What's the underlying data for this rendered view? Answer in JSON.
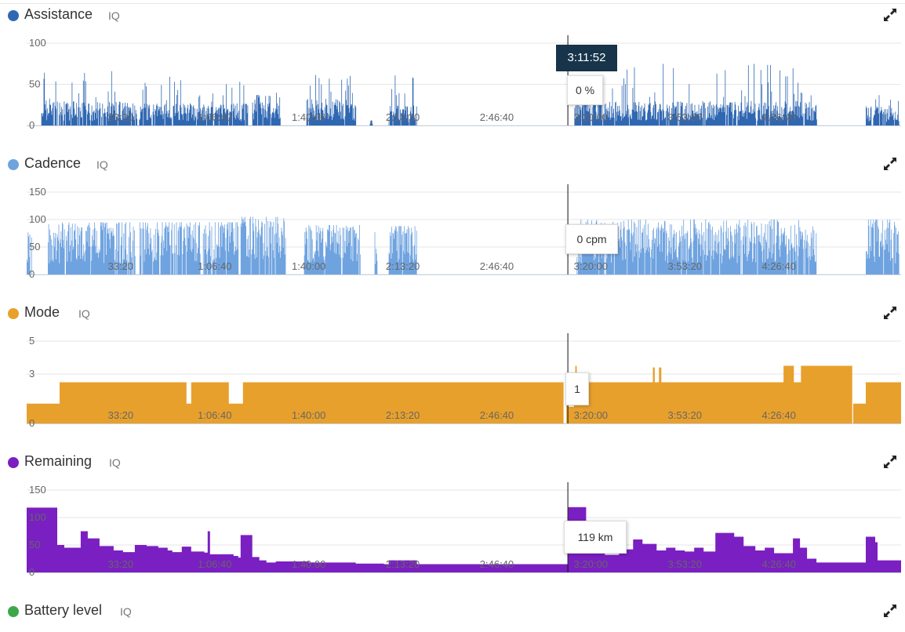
{
  "cursor": {
    "time_label": "3:11:52",
    "time_s": 11512
  },
  "x_axis": {
    "min_s": 0,
    "max_s": 18600,
    "ticks": [
      {
        "t": 2000,
        "label": "33:20"
      },
      {
        "t": 4000,
        "label": "1:06:40"
      },
      {
        "t": 6000,
        "label": "1:40:00"
      },
      {
        "t": 8000,
        "label": "2:13:20"
      },
      {
        "t": 10000,
        "label": "2:46:40"
      },
      {
        "t": 12000,
        "label": "3:20:00"
      },
      {
        "t": 14000,
        "label": "3:53:20"
      },
      {
        "t": 16000,
        "label": "4:26:40"
      }
    ]
  },
  "panels": [
    {
      "id": "assistance",
      "title": "Assistance",
      "iq": "IQ",
      "color": "#2f67b2",
      "expand_icon": "expand-arrows-icon",
      "tooltip": "0 %"
    },
    {
      "id": "cadence",
      "title": "Cadence",
      "iq": "IQ",
      "color": "#6fa3e0",
      "expand_icon": "expand-arrows-icon",
      "tooltip": "0 cpm"
    },
    {
      "id": "mode",
      "title": "Mode",
      "iq": "IQ",
      "color": "#e8a02c",
      "expand_icon": "expand-arrows-icon",
      "tooltip": "1"
    },
    {
      "id": "remaining",
      "title": "Remaining",
      "iq": "IQ",
      "color": "#7a1fc2",
      "expand_icon": "expand-arrows-icon",
      "tooltip": "119 km"
    },
    {
      "id": "battery",
      "title": "Battery level",
      "iq": "IQ",
      "color": "#3da84a",
      "expand_icon": "expand-arrows-icon"
    }
  ],
  "chart_data": [
    {
      "type": "area",
      "title": "Assistance",
      "ylim": [
        0,
        100
      ],
      "yticks": [
        0,
        50,
        100
      ],
      "unit": "%",
      "style": "spikes",
      "segments": [
        {
          "from": 300,
          "to": 2350,
          "level": 22,
          "peak": 70
        },
        {
          "from": 2380,
          "to": 4700,
          "level": 20,
          "peak": 60
        },
        {
          "from": 4800,
          "to": 5400,
          "level": 28,
          "peak": 50
        },
        {
          "from": 5950,
          "to": 7000,
          "level": 24,
          "peak": 62
        },
        {
          "from": 7300,
          "to": 7350,
          "level": 5,
          "peak": 10
        },
        {
          "from": 7700,
          "to": 8300,
          "level": 18,
          "peak": 65
        },
        {
          "from": 11650,
          "to": 16800,
          "level": 22,
          "peak": 75
        },
        {
          "from": 17850,
          "to": 18550,
          "level": 18,
          "peak": 40
        }
      ]
    },
    {
      "type": "area",
      "title": "Cadence",
      "ylim": [
        0,
        150
      ],
      "yticks": [
        0,
        50,
        100,
        150
      ],
      "unit": "cpm",
      "style": "spikes",
      "segments": [
        {
          "from": 0,
          "to": 100,
          "level": 70,
          "peak": 85
        },
        {
          "from": 450,
          "to": 2300,
          "level": 78,
          "peak": 95
        },
        {
          "from": 2400,
          "to": 3700,
          "level": 82,
          "peak": 95
        },
        {
          "from": 3750,
          "to": 4500,
          "level": 80,
          "peak": 95
        },
        {
          "from": 4550,
          "to": 5500,
          "level": 85,
          "peak": 105
        },
        {
          "from": 5900,
          "to": 7100,
          "level": 75,
          "peak": 90
        },
        {
          "from": 7400,
          "to": 7450,
          "level": 70,
          "peak": 80
        },
        {
          "from": 7700,
          "to": 8300,
          "level": 72,
          "peak": 88
        },
        {
          "from": 11700,
          "to": 16800,
          "level": 78,
          "peak": 100
        },
        {
          "from": 17850,
          "to": 18550,
          "level": 80,
          "peak": 100
        }
      ]
    },
    {
      "type": "area",
      "title": "Mode",
      "ylim": [
        0,
        5
      ],
      "yticks": [
        0,
        3,
        5
      ],
      "unit": "",
      "style": "steps",
      "steps": [
        [
          0,
          1.2
        ],
        [
          200,
          1.2
        ],
        [
          400,
          1.2
        ],
        [
          700,
          2.5
        ],
        [
          3380,
          2.5
        ],
        [
          3400,
          1.2
        ],
        [
          3500,
          2.5
        ],
        [
          4270,
          2.5
        ],
        [
          4300,
          1.2
        ],
        [
          4600,
          2.5
        ],
        [
          11400,
          2.5
        ],
        [
          11420,
          0
        ],
        [
          11480,
          2.5
        ],
        [
          11500,
          1.0
        ],
        [
          11600,
          1.0
        ],
        [
          11640,
          2.5
        ],
        [
          11670,
          3.5
        ],
        [
          11700,
          2.5
        ],
        [
          13300,
          2.5
        ],
        [
          13320,
          3.4
        ],
        [
          13360,
          2.5
        ],
        [
          13450,
          3.4
        ],
        [
          13500,
          2.5
        ],
        [
          16090,
          2.5
        ],
        [
          16100,
          3.5
        ],
        [
          16310,
          3.5
        ],
        [
          16320,
          2.5
        ],
        [
          16450,
          2.5
        ],
        [
          16470,
          3.5
        ],
        [
          17540,
          3.5
        ],
        [
          17560,
          0
        ],
        [
          17580,
          1.2
        ],
        [
          17830,
          1.2
        ],
        [
          17850,
          2.5
        ],
        [
          18600,
          2.5
        ]
      ]
    },
    {
      "type": "area",
      "title": "Remaining",
      "ylim": [
        0,
        150
      ],
      "yticks": [
        0,
        50,
        100,
        150
      ],
      "unit": "km",
      "style": "steps",
      "steps": [
        [
          0,
          118
        ],
        [
          650,
          50
        ],
        [
          800,
          45
        ],
        [
          1150,
          75
        ],
        [
          1300,
          62
        ],
        [
          1550,
          48
        ],
        [
          1850,
          40
        ],
        [
          2050,
          37
        ],
        [
          2300,
          50
        ],
        [
          2550,
          48
        ],
        [
          2800,
          45
        ],
        [
          3000,
          40
        ],
        [
          3100,
          37
        ],
        [
          3300,
          47
        ],
        [
          3500,
          38
        ],
        [
          3780,
          36
        ],
        [
          3850,
          75
        ],
        [
          3900,
          33
        ],
        [
          4400,
          30
        ],
        [
          4500,
          27
        ],
        [
          4550,
          68
        ],
        [
          4800,
          28
        ],
        [
          4950,
          22
        ],
        [
          5100,
          18
        ],
        [
          5300,
          20
        ],
        [
          5500,
          20
        ],
        [
          6000,
          18
        ],
        [
          7000,
          16
        ],
        [
          7600,
          15
        ],
        [
          7700,
          22
        ],
        [
          8300,
          15
        ],
        [
          11500,
          15
        ],
        [
          11520,
          119
        ],
        [
          11900,
          35
        ],
        [
          12300,
          32
        ],
        [
          12600,
          42
        ],
        [
          12900,
          60
        ],
        [
          13100,
          52
        ],
        [
          13400,
          40
        ],
        [
          13600,
          45
        ],
        [
          13800,
          40
        ],
        [
          14000,
          38
        ],
        [
          14200,
          45
        ],
        [
          14400,
          38
        ],
        [
          14650,
          72
        ],
        [
          15050,
          65
        ],
        [
          15250,
          48
        ],
        [
          15500,
          40
        ],
        [
          15700,
          45
        ],
        [
          15900,
          35
        ],
        [
          16300,
          62
        ],
        [
          16450,
          45
        ],
        [
          16600,
          25
        ],
        [
          16800,
          18
        ],
        [
          17000,
          18
        ],
        [
          17800,
          18
        ],
        [
          17850,
          65
        ],
        [
          18050,
          55
        ],
        [
          18100,
          22
        ],
        [
          18600,
          22
        ]
      ]
    }
  ]
}
